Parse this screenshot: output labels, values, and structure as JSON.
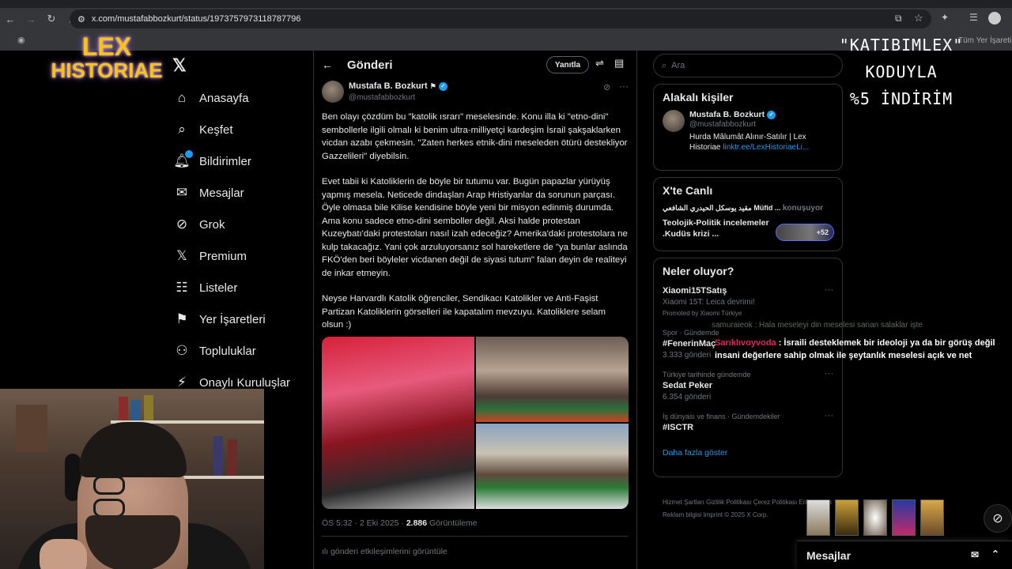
{
  "browser": {
    "url": "x.com/mustafabbozkurt/status/1973757973118787796",
    "bookmarks_right": "Tüm Yer İşareti"
  },
  "overlay": {
    "logo_line1": "LEX",
    "logo_line2": "HISTORIAE",
    "promo_line1": "\"KATIBIMLEX\" KODUYLA",
    "promo_line2": "%5 İNDİRİM"
  },
  "sidebar": {
    "items": [
      {
        "label": "Anasayfa",
        "icon": "home-icon"
      },
      {
        "label": "Keşfet",
        "icon": "search-icon"
      },
      {
        "label": "Bildirimler",
        "icon": "bell-icon"
      },
      {
        "label": "Mesajlar",
        "icon": "mail-icon"
      },
      {
        "label": "Grok",
        "icon": "grok-icon"
      },
      {
        "label": "Premium",
        "icon": "x-icon"
      },
      {
        "label": "Listeler",
        "icon": "list-icon"
      },
      {
        "label": "Yer İşaretleri",
        "icon": "bookmark-icon"
      },
      {
        "label": "Topluluklar",
        "icon": "people-icon"
      },
      {
        "label": "Onaylı Kuruluşlar",
        "icon": "lightning-icon"
      }
    ]
  },
  "post": {
    "header_title": "Gönderi",
    "reply_label": "Yanıtla",
    "author_name": "Mustafa B. Bozkurt",
    "author_handle": "@mustafabbozkurt",
    "paragraphs": [
      "Ben olayı çözdüm bu \"katolik ısrarı\" meselesinde. Konu illa ki \"etno-dini\" sembollerle ilgili olmalı ki benim ultra-milliyetçi kardeşim İsrail şakşaklarken vicdan azabı çekmesin. \"Zaten herkes etnik-dini meseleden ötürü destekliyor Gazzelileri\" diyebilsin.",
      "Evet tabii ki Katoliklerin de böyle bir tutumu var. Bugün papazlar yürüyüş yapmış mesela. Neticede dindaşları Arap Hristiyanlar da sorunun parçası. Öyle olmasa bile Kilise kendisine böyle yeni bir misyon edinmiş durumda. Ama konu sadece etno-dini semboller değil. Aksi halde protestan Kuzeybatı'daki protestoları nasıl izah edeceğiz? Amerika'daki protestolara ne kulp takacağız. Yani çok arzuluyorsanız sol hareketlere de \"ya bunlar aslında FKÖ'den beri böyleler vicdanen değil de siyasi tutum\" falan deyin de realiteyi de inkar etmeyin.",
      "Neyse Harvardlı Katolik  öğrenciler, Sendikacı Katolikler ve Anti-Faşist Partizan Katoliklerin görselleri ile kapatalım mevzuyu. Katoliklere selam olsun :)"
    ],
    "time": "ÖS 5:32 · 2 Eki 2025 · ",
    "views_count": "2.886",
    "views_label": " Görüntüleme",
    "engagement_link": "gönderi etkileşimlerini görüntüle"
  },
  "right": {
    "search_placeholder": "Ara",
    "related_title": "Alakalı kişiler",
    "related_name": "Mustafa B. Bozkurt",
    "related_handle": "@mustafabbozkurt",
    "related_bio": "Hurda Mâlumât Alınır-Satılır | Lex Historiae ",
    "related_link": "linktr.ee/LexHistoriaeLi...",
    "live_title": "X'te Canlı",
    "live_host": "مقيد يوسكل الحيدري الشافعي Müfid ...",
    "live_status": "konuşuyor",
    "live_topic": "Teolojik-Politik incelemeler .Kudüs krizi ...",
    "live_count": "+52",
    "happening_title": "Neler oluyor?",
    "trends": [
      {
        "context": "",
        "name": "Xiaomi15TSatış",
        "sub": "Xiaomi 15T: Leica devrimi!",
        "extra": "Promoted by Xiaomi Türkiye"
      },
      {
        "context": "Spor · Gündemde",
        "name": "#FenerinMaç",
        "sub": "3.333 gönderi",
        "extra": ""
      },
      {
        "context": "Türkiye tarihinde gündemde",
        "name": "Sedat Peker",
        "sub": "6.354 gönderi",
        "extra": ""
      },
      {
        "context": "İş dünyası ve finans · Gündemdekiler",
        "name": "#ISCTR",
        "sub": "",
        "extra": ""
      }
    ],
    "show_more": "Daha fazla göster",
    "footer": "Hizmet Şartları   Gizlilik Politikası   Çerez Politikası   Erişilebilirlik   Reklam bilgisi   Imprint   © 2025 X Corp."
  },
  "chat": {
    "line1": "samuraieok : Hala meseleyi din meselesi sanan salaklar işte",
    "user2": "Sarıklıvoyvoda",
    "line2": " : İsraili desteklemek bir ideoloji ya da bir görüş değil insani değerlere sahip olmak ile şeytanlık meselesi açık ve net"
  },
  "dm_bar_label": "Mesajlar"
}
